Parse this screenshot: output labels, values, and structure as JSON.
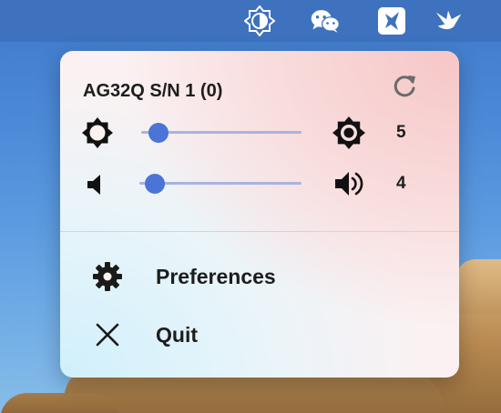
{
  "menubar": {
    "icons": [
      "brightness-menu-icon",
      "wechat-icon",
      "feishu-icon",
      "bird-app-icon"
    ]
  },
  "popover": {
    "device_title": "AG32Q S/N 1 (0)",
    "refresh_icon": "refresh-icon",
    "brightness": {
      "low_icon": "brightness-low-icon",
      "high_icon": "brightness-high-icon",
      "value": "5",
      "level_fraction": 0.05
    },
    "volume": {
      "low_icon": "volume-low-icon",
      "high_icon": "volume-high-icon",
      "value": "4",
      "level_fraction": 0.04
    },
    "menu": {
      "preferences_label": "Preferences",
      "preferences_icon": "gear-icon",
      "quit_label": "Quit",
      "quit_icon": "close-icon"
    }
  },
  "colors": {
    "menubar": "#3e72be",
    "slider_knob": "#4a74d6",
    "slider_track": "#a9b3e0"
  }
}
